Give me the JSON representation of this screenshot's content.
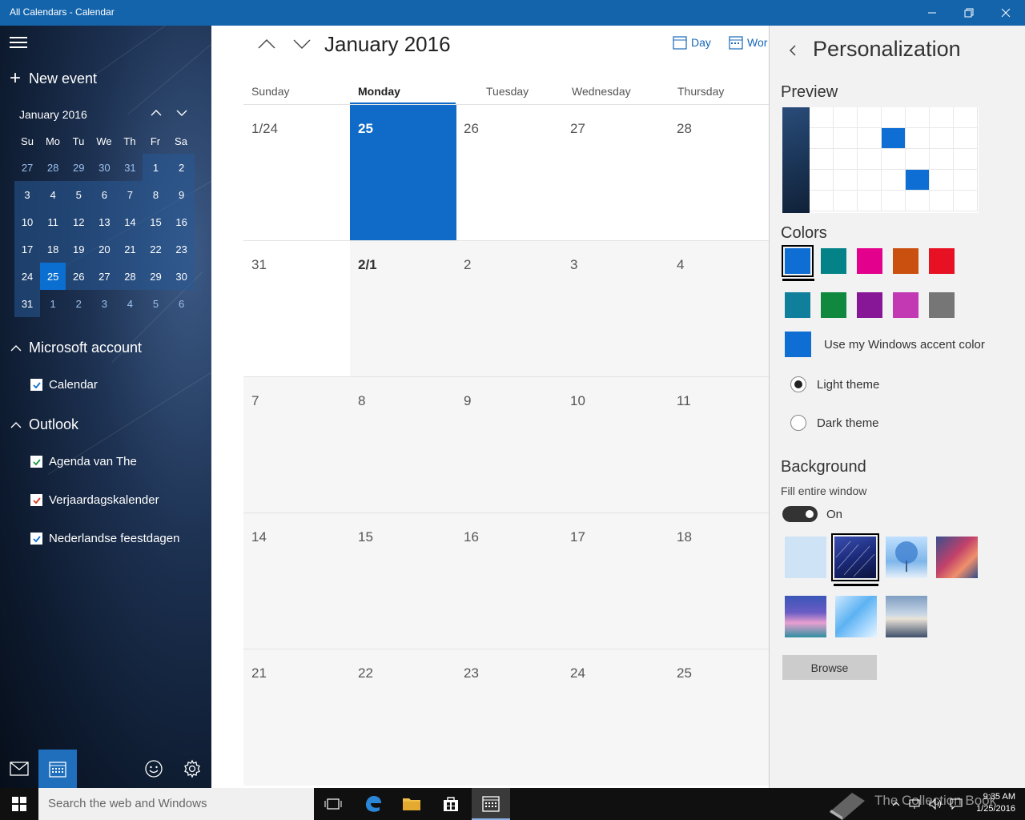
{
  "window": {
    "title": "All Calendars - Calendar"
  },
  "sidebar": {
    "new_event_label": "New event",
    "mini_calendar": {
      "title": "January 2016",
      "weekdays": [
        "Su",
        "Mo",
        "Tu",
        "We",
        "Th",
        "Fr",
        "Sa"
      ],
      "weeks": [
        [
          "27",
          "28",
          "29",
          "30",
          "31",
          "1",
          "2"
        ],
        [
          "3",
          "4",
          "5",
          "6",
          "7",
          "8",
          "9"
        ],
        [
          "10",
          "11",
          "12",
          "13",
          "14",
          "15",
          "16"
        ],
        [
          "17",
          "18",
          "19",
          "20",
          "21",
          "22",
          "23"
        ],
        [
          "24",
          "25",
          "26",
          "27",
          "28",
          "29",
          "30"
        ],
        [
          "31",
          "1",
          "2",
          "3",
          "4",
          "5",
          "6"
        ]
      ],
      "today": "25"
    },
    "groups": [
      {
        "name": "Microsoft account",
        "calendars": [
          {
            "label": "Calendar",
            "color": "#0f6ed3"
          }
        ]
      },
      {
        "name": "Outlook",
        "calendars": [
          {
            "label": "Agenda van The",
            "color": "#1a9a40"
          },
          {
            "label": "Verjaardagskalender",
            "color": "#d83b20"
          },
          {
            "label": "Nederlandse feestdagen",
            "color": "#0f6ed3"
          }
        ]
      }
    ]
  },
  "main": {
    "month_title": "January 2016",
    "views": {
      "day": "Day",
      "week": "Wor"
    },
    "weekdays": [
      "Sunday",
      "Monday",
      "Tuesday",
      "Wednesday",
      "Thursday"
    ],
    "weeks": [
      [
        "1/24",
        "25",
        "26",
        "27",
        "28"
      ],
      [
        "31",
        "2/1",
        "2",
        "3",
        "4"
      ],
      [
        "7",
        "8",
        "9",
        "10",
        "11"
      ],
      [
        "14",
        "15",
        "16",
        "17",
        "18"
      ],
      [
        "21",
        "22",
        "23",
        "24",
        "25"
      ]
    ]
  },
  "personalization": {
    "title": "Personalization",
    "preview_heading": "Preview",
    "colors_heading": "Colors",
    "colors": [
      "#0f6ed3",
      "#038387",
      "#e3008c",
      "#ca5010",
      "#e81123",
      "#0f7f9b",
      "#10893e",
      "#881798",
      "#c239b3",
      "#767676"
    ],
    "selected_color": "#0f6ed3",
    "accent_label": "Use my Windows accent color",
    "themes": [
      {
        "label": "Light theme",
        "selected": true
      },
      {
        "label": "Dark theme",
        "selected": false
      }
    ],
    "background_heading": "Background",
    "fill_label": "Fill entire window",
    "toggle_state": "On",
    "browse_label": "Browse"
  },
  "taskbar": {
    "search_placeholder": "Search the web and Windows",
    "watermark": "The Collection Book",
    "time": "9:35 AM",
    "date": "1/25/2016"
  }
}
